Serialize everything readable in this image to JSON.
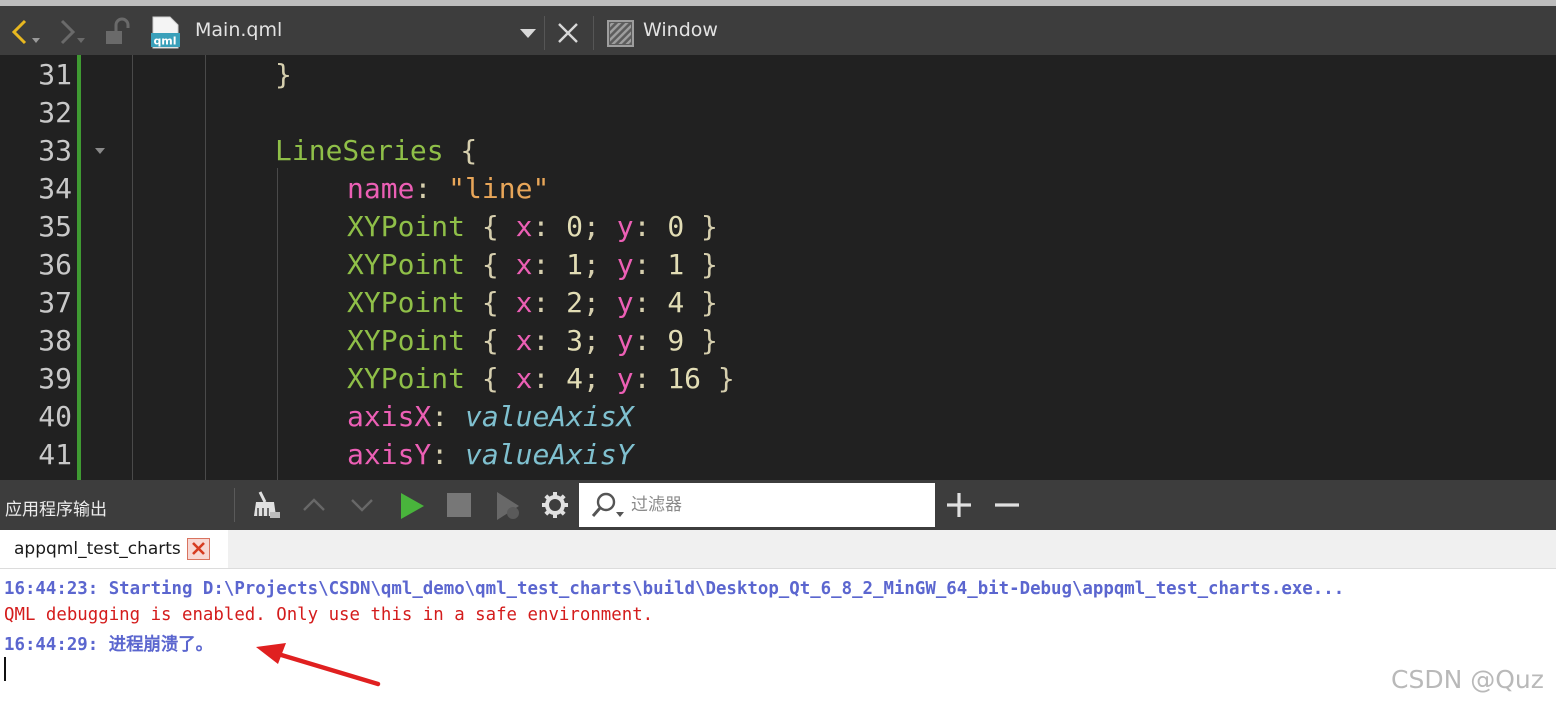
{
  "toolbar": {
    "file_name": "Main.qml",
    "file_icon_text": "qml",
    "window_label": "Window",
    "icons": [
      "back-arrow-icon",
      "forward-arrow-icon",
      "lock-icon",
      "qml-file-icon",
      "dropdown-icon",
      "close-icon",
      "window-symbol-icon"
    ]
  },
  "editor": {
    "line_numbers": [
      "31",
      "32",
      "33",
      "34",
      "35",
      "36",
      "37",
      "38",
      "39",
      "40",
      "41"
    ],
    "lines": {
      "l31": "}",
      "l33_type": "LineSeries",
      "l33_brace": " {",
      "l34_prop": "name",
      "l34_colon": ": ",
      "l34_str": "\"line\"",
      "points": [
        {
          "type": "XYPoint",
          "x": "0",
          "y": "0"
        },
        {
          "type": "XYPoint",
          "x": "1",
          "y": "1"
        },
        {
          "type": "XYPoint",
          "x": "2",
          "y": "4"
        },
        {
          "type": "XYPoint",
          "x": "3",
          "y": "9"
        },
        {
          "type": "XYPoint",
          "x": "4",
          "y": "16"
        }
      ],
      "l40_prop": "axisX",
      "l40_val": "valueAxisX",
      "l41_prop": "axisY",
      "l41_val": "valueAxisY"
    },
    "colors": {
      "background": "#212121",
      "type": "#8fbf48",
      "property": "#ec5fb5",
      "string": "#e8a659",
      "change_bar": "#3f9a32"
    }
  },
  "output_pane": {
    "title": "应用程序输出",
    "filter_placeholder": "过滤器",
    "icons": [
      "clean-icon",
      "up-icon",
      "down-icon",
      "run-icon",
      "stop-icon",
      "debug-icon",
      "settings-gear-icon",
      "search-icon",
      "plus-icon",
      "minus-icon"
    ],
    "tab_label": "appqml_test_charts",
    "lines": [
      "16:44:23: Starting D:\\Projects\\CSDN\\qml_demo\\qml_test_charts\\build\\Desktop_Qt_6_8_2_MinGW_64_bit-Debug\\appqml_test_charts.exe...",
      "QML debugging is enabled. Only use this in a safe environment.",
      "16:44:29: 进程崩溃了。"
    ],
    "colors": {
      "info": "#5b66cf",
      "warning": "#d41c1c"
    }
  },
  "watermark": "CSDN @Quz",
  "annotation": {
    "arrow_color": "#e02020"
  }
}
